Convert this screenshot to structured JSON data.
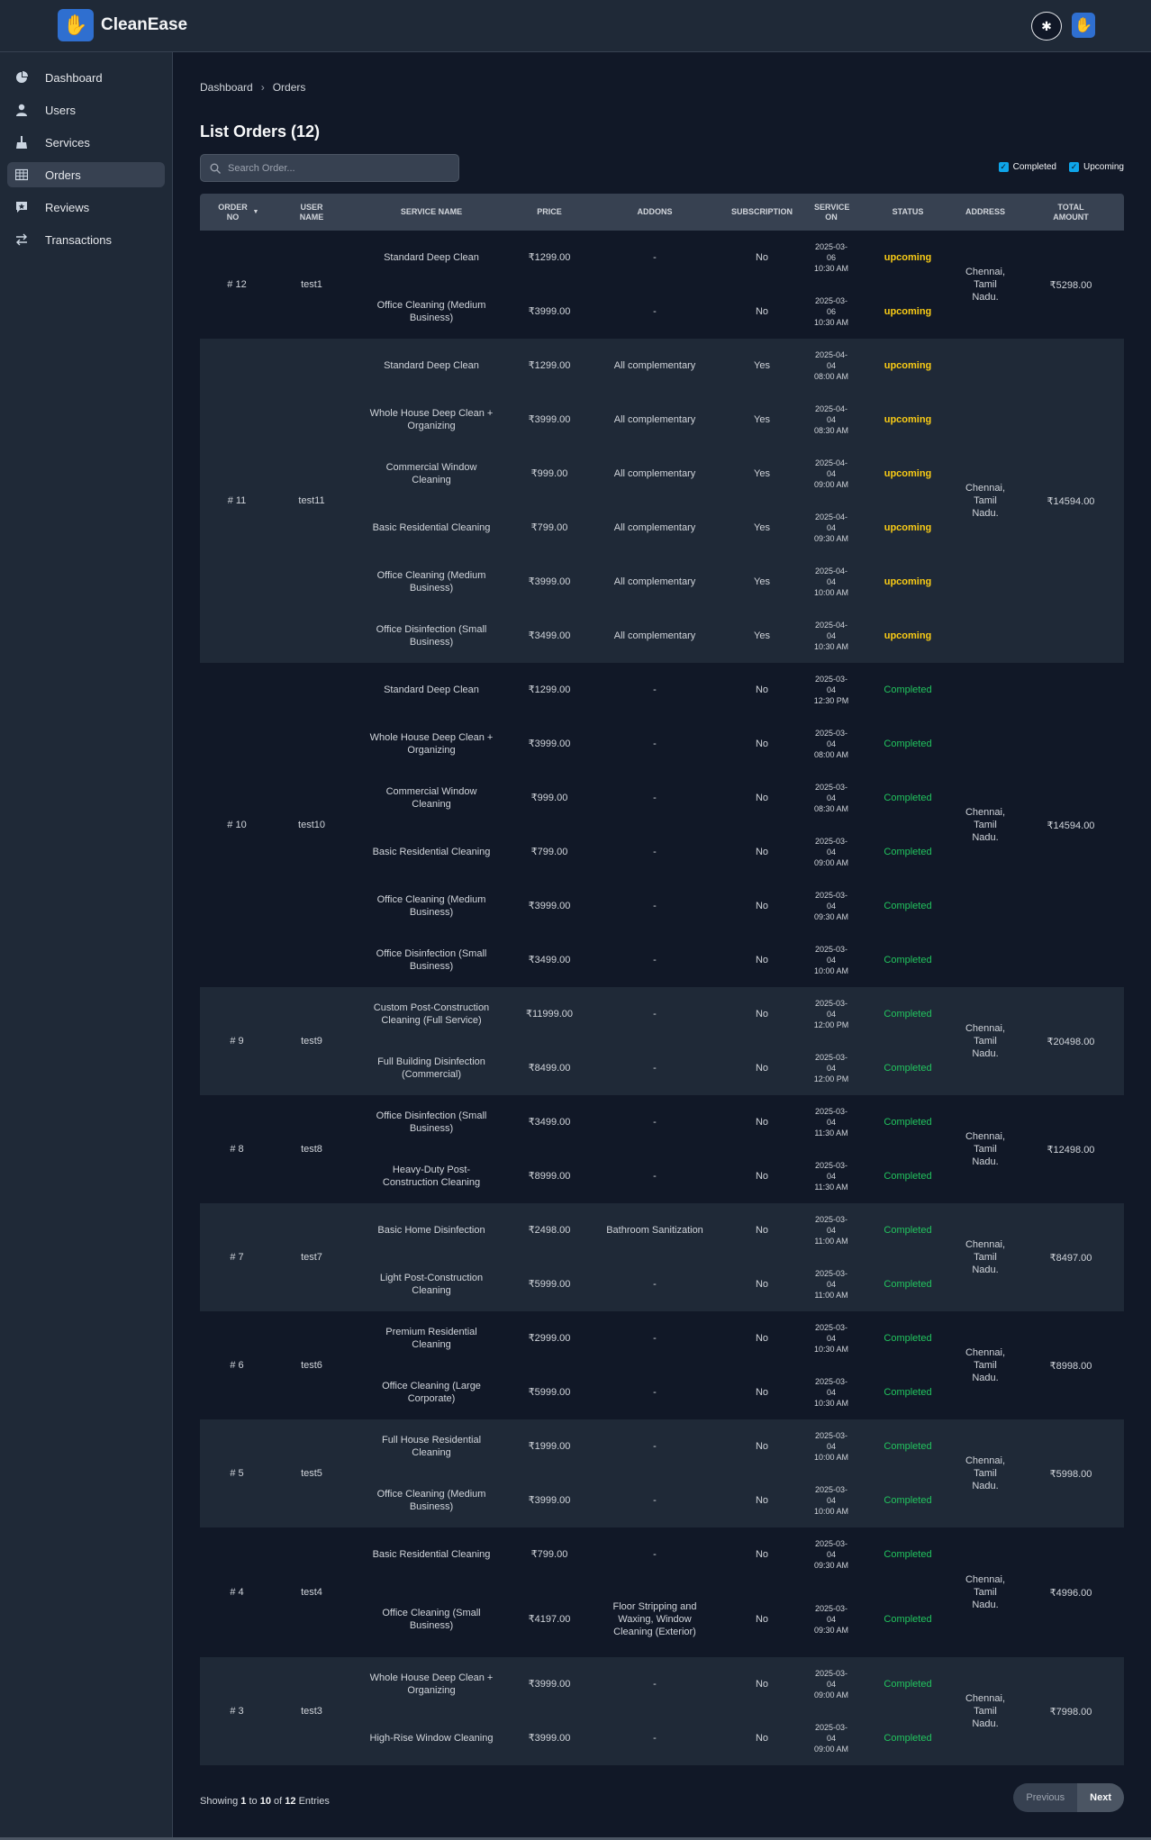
{
  "app": {
    "name": "CleanEase"
  },
  "sidebar": {
    "items": [
      {
        "label": "Dashboard",
        "icon": "pie-chart-icon"
      },
      {
        "label": "Users",
        "icon": "user-icon"
      },
      {
        "label": "Services",
        "icon": "broom-icon"
      },
      {
        "label": "Orders",
        "icon": "table-icon",
        "active": true
      },
      {
        "label": "Reviews",
        "icon": "review-icon"
      },
      {
        "label": "Transactions",
        "icon": "transfer-icon"
      }
    ]
  },
  "breadcrumb": {
    "root": "Dashboard",
    "current": "Orders"
  },
  "page": {
    "title": "List Orders (12)"
  },
  "search": {
    "placeholder": "Search Order..."
  },
  "filters": {
    "completed": "Completed",
    "upcoming": "Upcoming"
  },
  "table": {
    "headers": {
      "order_no": "ORDER NO",
      "user_name": "USER NAME",
      "service_name": "SERVICE NAME",
      "price": "PRICE",
      "addons": "ADDONS",
      "subscription": "SUBSCRIPTION",
      "service_on": "SERVICE ON",
      "status": "STATUS",
      "address": "ADDRESS",
      "total_amount": "TOTAL AMOUNT"
    },
    "orders": [
      {
        "no": "# 12",
        "user": "test1",
        "address": "Chennai, Tamil Nadu.",
        "total": "₹5298.00",
        "items": [
          {
            "service": "Standard Deep Clean",
            "price": "₹1299.00",
            "addons": "-",
            "sub": "No",
            "date": [
              "2025-03-",
              "06",
              "10:30 AM"
            ],
            "status": "upcoming"
          },
          {
            "service": "Office Cleaning (Medium Business)",
            "price": "₹3999.00",
            "addons": "-",
            "sub": "No",
            "date": [
              "2025-03-",
              "06",
              "10:30 AM"
            ],
            "status": "upcoming"
          }
        ]
      },
      {
        "no": "# 11",
        "user": "test11",
        "address": "Chennai, Tamil Nadu.",
        "total": "₹14594.00",
        "items": [
          {
            "service": "Standard Deep Clean",
            "price": "₹1299.00",
            "addons": "All complementary",
            "sub": "Yes",
            "date": [
              "2025-04-",
              "04",
              "08:00 AM"
            ],
            "status": "upcoming"
          },
          {
            "service": "Whole House Deep Clean + Organizing",
            "price": "₹3999.00",
            "addons": "All complementary",
            "sub": "Yes",
            "date": [
              "2025-04-",
              "04",
              "08:30 AM"
            ],
            "status": "upcoming"
          },
          {
            "service": "Commercial Window Cleaning",
            "price": "₹999.00",
            "addons": "All complementary",
            "sub": "Yes",
            "date": [
              "2025-04-",
              "04",
              "09:00 AM"
            ],
            "status": "upcoming"
          },
          {
            "service": "Basic Residential Cleaning",
            "price": "₹799.00",
            "addons": "All complementary",
            "sub": "Yes",
            "date": [
              "2025-04-",
              "04",
              "09:30 AM"
            ],
            "status": "upcoming"
          },
          {
            "service": "Office Cleaning (Medium Business)",
            "price": "₹3999.00",
            "addons": "All complementary",
            "sub": "Yes",
            "date": [
              "2025-04-",
              "04",
              "10:00 AM"
            ],
            "status": "upcoming"
          },
          {
            "service": "Office Disinfection (Small Business)",
            "price": "₹3499.00",
            "addons": "All complementary",
            "sub": "Yes",
            "date": [
              "2025-04-",
              "04",
              "10:30 AM"
            ],
            "status": "upcoming"
          }
        ]
      },
      {
        "no": "# 10",
        "user": "test10",
        "address": "Chennai, Tamil Nadu.",
        "total": "₹14594.00",
        "items": [
          {
            "service": "Standard Deep Clean",
            "price": "₹1299.00",
            "addons": "-",
            "sub": "No",
            "date": [
              "2025-03-",
              "04",
              "12:30 PM"
            ],
            "status": "Completed"
          },
          {
            "service": "Whole House Deep Clean + Organizing",
            "price": "₹3999.00",
            "addons": "-",
            "sub": "No",
            "date": [
              "2025-03-",
              "04",
              "08:00 AM"
            ],
            "status": "Completed"
          },
          {
            "service": "Commercial Window Cleaning",
            "price": "₹999.00",
            "addons": "-",
            "sub": "No",
            "date": [
              "2025-03-",
              "04",
              "08:30 AM"
            ],
            "status": "Completed"
          },
          {
            "service": "Basic Residential Cleaning",
            "price": "₹799.00",
            "addons": "-",
            "sub": "No",
            "date": [
              "2025-03-",
              "04",
              "09:00 AM"
            ],
            "status": "Completed"
          },
          {
            "service": "Office Cleaning (Medium Business)",
            "price": "₹3999.00",
            "addons": "-",
            "sub": "No",
            "date": [
              "2025-03-",
              "04",
              "09:30 AM"
            ],
            "status": "Completed"
          },
          {
            "service": "Office Disinfection (Small Business)",
            "price": "₹3499.00",
            "addons": "-",
            "sub": "No",
            "date": [
              "2025-03-",
              "04",
              "10:00 AM"
            ],
            "status": "Completed"
          }
        ]
      },
      {
        "no": "# 9",
        "user": "test9",
        "address": "Chennai, Tamil Nadu.",
        "total": "₹20498.00",
        "items": [
          {
            "service": "Custom Post-Construction Cleaning (Full Service)",
            "price": "₹11999.00",
            "addons": "-",
            "sub": "No",
            "date": [
              "2025-03-",
              "04",
              "12:00 PM"
            ],
            "status": "Completed"
          },
          {
            "service": "Full Building Disinfection (Commercial)",
            "price": "₹8499.00",
            "addons": "-",
            "sub": "No",
            "date": [
              "2025-03-",
              "04",
              "12:00 PM"
            ],
            "status": "Completed"
          }
        ]
      },
      {
        "no": "# 8",
        "user": "test8",
        "address": "Chennai, Tamil Nadu.",
        "total": "₹12498.00",
        "items": [
          {
            "service": "Office Disinfection (Small Business)",
            "price": "₹3499.00",
            "addons": "-",
            "sub": "No",
            "date": [
              "2025-03-",
              "04",
              "11:30 AM"
            ],
            "status": "Completed"
          },
          {
            "service": "Heavy-Duty Post-Construction Cleaning",
            "price": "₹8999.00",
            "addons": "-",
            "sub": "No",
            "date": [
              "2025-03-",
              "04",
              "11:30 AM"
            ],
            "status": "Completed"
          }
        ]
      },
      {
        "no": "# 7",
        "user": "test7",
        "address": "Chennai, Tamil Nadu.",
        "total": "₹8497.00",
        "items": [
          {
            "service": "Basic Home Disinfection",
            "price": "₹2498.00",
            "addons": "Bathroom Sanitization",
            "sub": "No",
            "date": [
              "2025-03-",
              "04",
              "11:00 AM"
            ],
            "status": "Completed"
          },
          {
            "service": "Light Post-Construction Cleaning",
            "price": "₹5999.00",
            "addons": "-",
            "sub": "No",
            "date": [
              "2025-03-",
              "04",
              "11:00 AM"
            ],
            "status": "Completed"
          }
        ]
      },
      {
        "no": "# 6",
        "user": "test6",
        "address": "Chennai, Tamil Nadu.",
        "total": "₹8998.00",
        "items": [
          {
            "service": "Premium Residential Cleaning",
            "price": "₹2999.00",
            "addons": "-",
            "sub": "No",
            "date": [
              "2025-03-",
              "04",
              "10:30 AM"
            ],
            "status": "Completed"
          },
          {
            "service": "Office Cleaning (Large Corporate)",
            "price": "₹5999.00",
            "addons": "-",
            "sub": "No",
            "date": [
              "2025-03-",
              "04",
              "10:30 AM"
            ],
            "status": "Completed"
          }
        ]
      },
      {
        "no": "# 5",
        "user": "test5",
        "address": "Chennai, Tamil Nadu.",
        "total": "₹5998.00",
        "items": [
          {
            "service": "Full House Residential Cleaning",
            "price": "₹1999.00",
            "addons": "-",
            "sub": "No",
            "date": [
              "2025-03-",
              "04",
              "10:00 AM"
            ],
            "status": "Completed"
          },
          {
            "service": "Office Cleaning (Medium Business)",
            "price": "₹3999.00",
            "addons": "-",
            "sub": "No",
            "date": [
              "2025-03-",
              "04",
              "10:00 AM"
            ],
            "status": "Completed"
          }
        ]
      },
      {
        "no": "# 4",
        "user": "test4",
        "address": "Chennai, Tamil Nadu.",
        "total": "₹4996.00",
        "items": [
          {
            "service": "Basic Residential Cleaning",
            "price": "₹799.00",
            "addons": "-",
            "sub": "No",
            "date": [
              "2025-03-",
              "04",
              "09:30 AM"
            ],
            "status": "Completed"
          },
          {
            "service": "Office Cleaning (Small Business)",
            "price": "₹4197.00",
            "addons": "Floor Stripping and Waxing, Window Cleaning (Exterior)",
            "sub": "No",
            "date": [
              "2025-03-",
              "04",
              "09:30 AM"
            ],
            "status": "Completed",
            "tall": true
          }
        ]
      },
      {
        "no": "# 3",
        "user": "test3",
        "address": "Chennai, Tamil Nadu.",
        "total": "₹7998.00",
        "items": [
          {
            "service": "Whole House Deep Clean + Organizing",
            "price": "₹3999.00",
            "addons": "-",
            "sub": "No",
            "date": [
              "2025-03-",
              "04",
              "09:00 AM"
            ],
            "status": "Completed"
          },
          {
            "service": "High-Rise Window Cleaning",
            "price": "₹3999.00",
            "addons": "-",
            "sub": "No",
            "date": [
              "2025-03-",
              "04",
              "09:00 AM"
            ],
            "status": "Completed"
          }
        ]
      }
    ]
  },
  "pagination": {
    "showing": "Showing",
    "from": "1",
    "to_word": "to",
    "to": "10",
    "of_word": "of",
    "total": "12",
    "entries": "Entries",
    "prev": "Previous",
    "next": "Next"
  },
  "colors": {
    "bg": "#111827",
    "panel": "#1f2937",
    "upcoming": "#facc15",
    "completed": "#22c55e",
    "accent": "#2f6fd0"
  }
}
